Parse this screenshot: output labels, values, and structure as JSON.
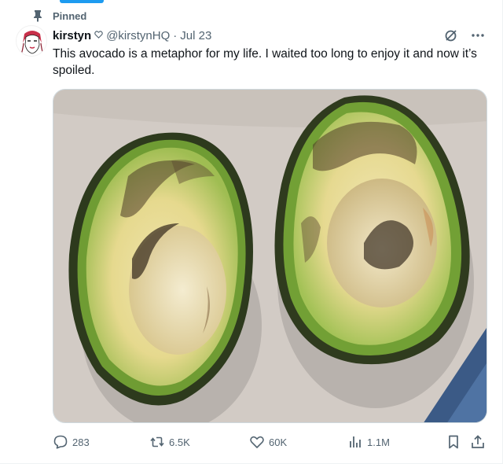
{
  "pinned_label": "Pinned",
  "author": {
    "name": "kirstyn",
    "badge_icon": "heart-outline-icon",
    "handle": "@kirstynHQ",
    "separator": "·",
    "date": "Jul 23"
  },
  "tweet": {
    "text": "This avocado is a metaphor for my life. I waited too long to enjoy it and now it’s spoiled."
  },
  "media": {
    "description_icon": "avocado-photo"
  },
  "actions": {
    "replies": "283",
    "reposts": "6.5K",
    "likes": "60K",
    "views": "1.1M"
  },
  "colors": {
    "accent": "#1d9bf0",
    "text_primary": "#0f1419",
    "text_secondary": "#536471",
    "border": "#cfd9de"
  }
}
